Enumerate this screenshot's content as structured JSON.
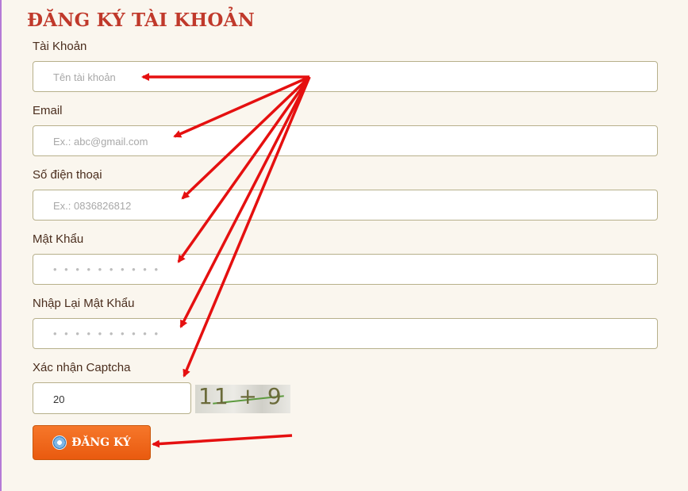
{
  "form": {
    "title": "ĐĂNG KÝ TÀI KHOẢN",
    "fields": [
      {
        "label": "Tài Khoản",
        "placeholder": "Tên tài khoản"
      },
      {
        "label": "Email",
        "placeholder": "Ex.: abc@gmail.com"
      },
      {
        "label": "Số điện thoại",
        "placeholder": "Ex.: 0836826812"
      },
      {
        "label": "Mật Khẩu",
        "placeholder": "• • • • • • • • • •"
      },
      {
        "label": "Nhập Lại Mật Khẩu",
        "placeholder": "• • • • • • • • • •"
      }
    ],
    "captcha": {
      "label": "Xác nhận Captcha",
      "value": "20",
      "image_text": "11 + 9 ="
    },
    "submit_label": "ĐĂNG KÝ"
  },
  "annotation": {
    "arrow_color": "#e51010"
  }
}
